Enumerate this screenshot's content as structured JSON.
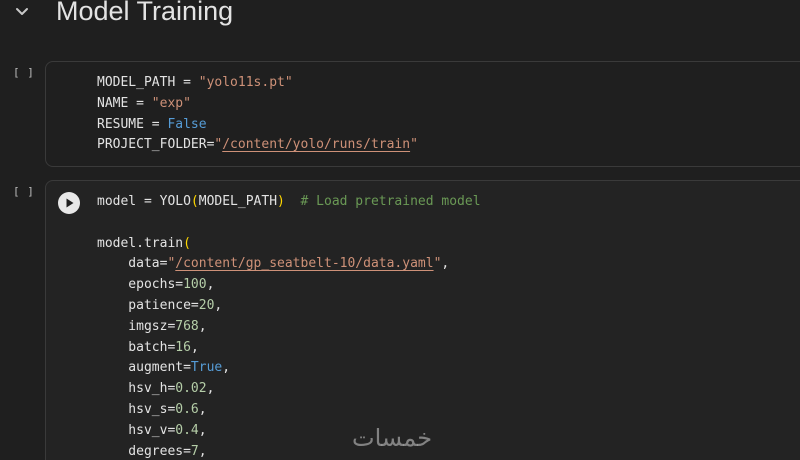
{
  "section": {
    "title": "Model Training",
    "toggle_icon": "chevron-down-icon"
  },
  "cells": [
    {
      "exec_count": "[ ]",
      "lines": [
        [
          {
            "t": "MODEL_PATH = ",
            "c": ""
          },
          {
            "t": "\"yolo11s.pt\"",
            "c": "str"
          }
        ],
        [
          {
            "t": "NAME = ",
            "c": ""
          },
          {
            "t": "\"exp\"",
            "c": "str"
          }
        ],
        [
          {
            "t": "RESUME = ",
            "c": ""
          },
          {
            "t": "False",
            "c": "kw"
          }
        ],
        [
          {
            "t": "PROJECT_FOLDER=",
            "c": ""
          },
          {
            "t": "\"",
            "c": "str"
          },
          {
            "t": "/content/yolo/runs/train",
            "c": "path"
          },
          {
            "t": "\"",
            "c": "str"
          }
        ]
      ]
    },
    {
      "exec_count": "[ ]",
      "run_icon": "play-icon",
      "lines": [
        [
          {
            "t": "model = YOLO",
            "c": ""
          },
          {
            "t": "(",
            "c": "paren"
          },
          {
            "t": "MODEL_PATH",
            "c": ""
          },
          {
            "t": ")",
            "c": "paren"
          },
          {
            "t": "  ",
            "c": ""
          },
          {
            "t": "# Load pretrained model",
            "c": "comment"
          }
        ],
        [
          {
            "t": "",
            "c": ""
          }
        ],
        [
          {
            "t": "model.train",
            "c": ""
          },
          {
            "t": "(",
            "c": "paren"
          }
        ],
        [
          {
            "t": "    data=",
            "c": ""
          },
          {
            "t": "\"",
            "c": "str"
          },
          {
            "t": "/content/gp_seatbelt-10/data.yaml",
            "c": "path"
          },
          {
            "t": "\"",
            "c": "str"
          },
          {
            "t": ",",
            "c": ""
          }
        ],
        [
          {
            "t": "    epochs=",
            "c": ""
          },
          {
            "t": "100",
            "c": "num"
          },
          {
            "t": ",",
            "c": ""
          }
        ],
        [
          {
            "t": "    patience=",
            "c": ""
          },
          {
            "t": "20",
            "c": "num"
          },
          {
            "t": ",",
            "c": ""
          }
        ],
        [
          {
            "t": "    imgsz=",
            "c": ""
          },
          {
            "t": "768",
            "c": "num"
          },
          {
            "t": ",",
            "c": ""
          }
        ],
        [
          {
            "t": "    batch=",
            "c": ""
          },
          {
            "t": "16",
            "c": "num"
          },
          {
            "t": ",",
            "c": ""
          }
        ],
        [
          {
            "t": "    augment=",
            "c": ""
          },
          {
            "t": "True",
            "c": "kw"
          },
          {
            "t": ",",
            "c": ""
          }
        ],
        [
          {
            "t": "    hsv_h=",
            "c": ""
          },
          {
            "t": "0.02",
            "c": "num"
          },
          {
            "t": ",",
            "c": ""
          }
        ],
        [
          {
            "t": "    hsv_s=",
            "c": ""
          },
          {
            "t": "0.6",
            "c": "num"
          },
          {
            "t": ",",
            "c": ""
          }
        ],
        [
          {
            "t": "    hsv_v=",
            "c": ""
          },
          {
            "t": "0.4",
            "c": "num"
          },
          {
            "t": ",",
            "c": ""
          }
        ],
        [
          {
            "t": "    degrees=",
            "c": ""
          },
          {
            "t": "7",
            "c": "num"
          },
          {
            "t": ",",
            "c": ""
          }
        ]
      ]
    }
  ],
  "watermark": "خمسات",
  "colors": {
    "background": "#1f1f1f",
    "string": "#ce9178",
    "number": "#b5cea8",
    "keyword": "#569cd6",
    "comment": "#6a9955",
    "paren": "#ffd700"
  }
}
